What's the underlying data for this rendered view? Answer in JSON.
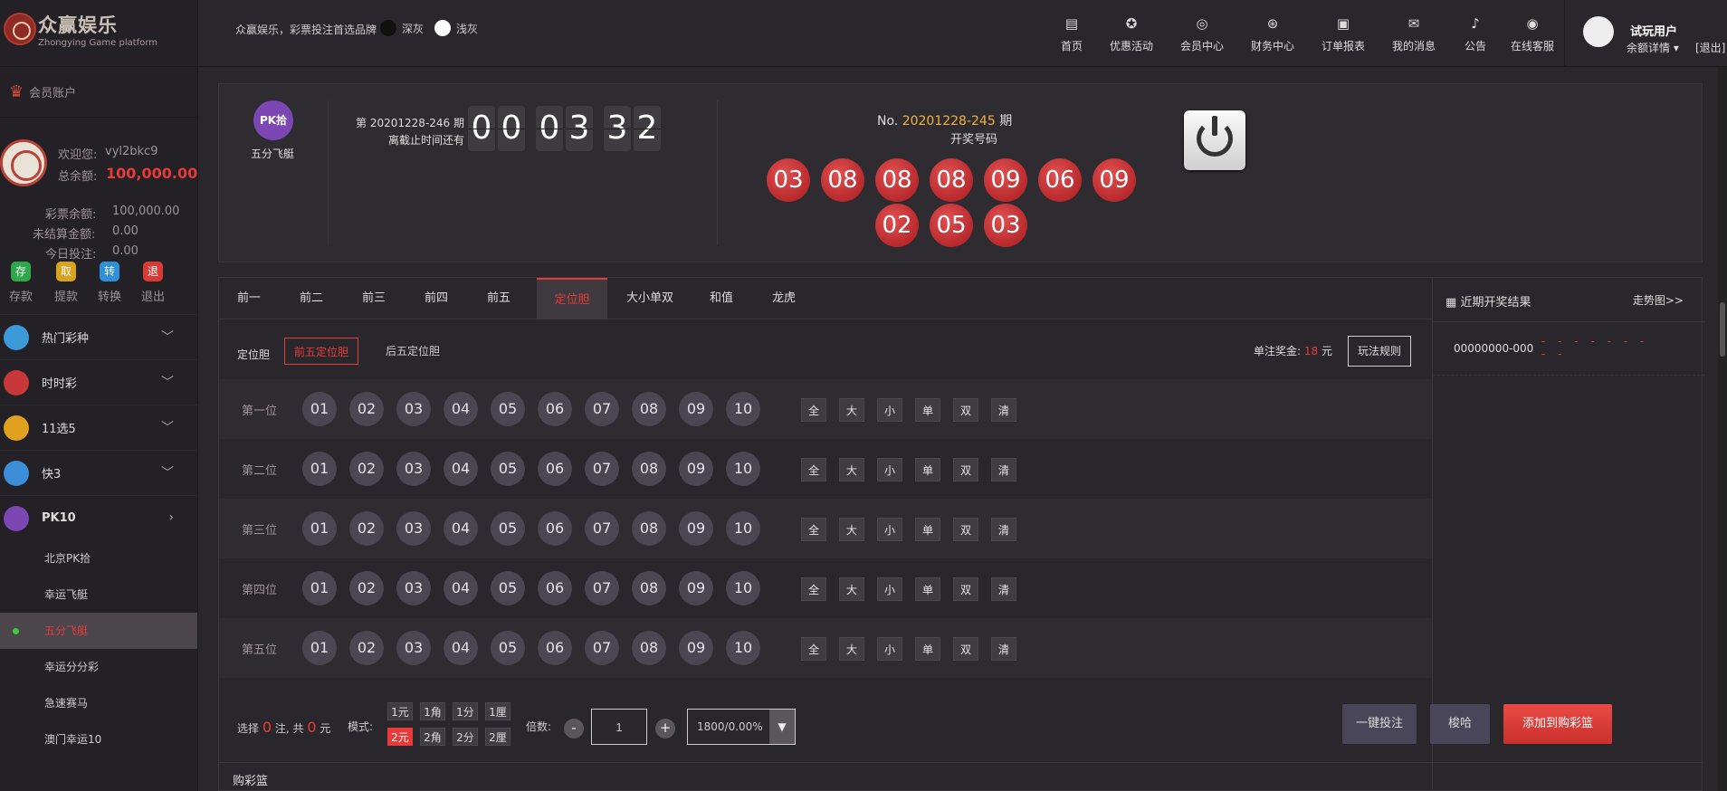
{
  "brand": {
    "name": "众赢娱乐",
    "sub": "Zhongying Game platform"
  },
  "header": {
    "slogan": "众赢娱乐，彩票投注首选品牌",
    "theme_dark": "深灰",
    "theme_light": "浅灰",
    "nav": [
      {
        "label": "首页",
        "icon": "home-icon"
      },
      {
        "label": "优惠活动",
        "icon": "gift-icon"
      },
      {
        "label": "会员中心",
        "icon": "user-icon"
      },
      {
        "label": "财务中心",
        "icon": "finance-icon"
      },
      {
        "label": "订单报表",
        "icon": "report-icon"
      },
      {
        "label": "我的消息",
        "icon": "mail-icon"
      },
      {
        "label": "公告",
        "icon": "bell-icon"
      },
      {
        "label": "在线客服",
        "icon": "support-icon"
      }
    ],
    "user": {
      "name": "试玩用户",
      "detail": "余额详情",
      "logout": "[退出]"
    }
  },
  "sidebar": {
    "account_title": "会员账户",
    "welcome_label": "欢迎您:",
    "username": "vyl2bkc9",
    "total_label": "总余额:",
    "total_value": "100,000.00",
    "lottery_label": "彩票余额:",
    "lottery_value": "100,000.00",
    "unsettled_label": "未结算金额:",
    "unsettled_value": "0.00",
    "today_label": "今日投注:",
    "today_value": "0.00",
    "quick": [
      {
        "icon": "存",
        "label": "存款",
        "color": "#2ea84a"
      },
      {
        "icon": "取",
        "label": "提款",
        "color": "#d8a11e"
      },
      {
        "icon": "转",
        "label": "转换",
        "color": "#2f8fd8"
      },
      {
        "icon": "退",
        "label": "退出",
        "color": "#d83a36"
      }
    ],
    "categories": [
      {
        "label": "热门彩种",
        "color": "#3d9ad9"
      },
      {
        "label": "时时彩",
        "color": "#c8383a"
      },
      {
        "label": "11选5",
        "color": "#e0a11f"
      },
      {
        "label": "快3",
        "color": "#3c8ed8"
      },
      {
        "label": "PK10",
        "color": "#7d47b3"
      }
    ],
    "sub_items": [
      "北京PK拾",
      "幸运飞艇",
      "五分飞艇",
      "幸运分分彩",
      "急速赛马",
      "澳门幸运10"
    ]
  },
  "game": {
    "icon_text": "PK拾",
    "name": "五分飞艇",
    "issue_line": "第 20201228-246 期",
    "deadline_label": "离截止时间还有",
    "countdown": [
      "0",
      "0",
      "0",
      "3",
      "3",
      "2"
    ],
    "last_no_prefix": "No.",
    "last_no": "20201228-245",
    "last_no_suffix": "期",
    "draw_label": "开奖号码",
    "draw_numbers": [
      "03",
      "08",
      "08",
      "08",
      "09",
      "06",
      "09",
      "02",
      "05",
      "03"
    ]
  },
  "bet": {
    "tabs": [
      "前一",
      "前二",
      "前三",
      "前四",
      "前五",
      "定位胆",
      "大小单双",
      "和值",
      "龙虎"
    ],
    "active_tab": 5,
    "sub_label": "定位胆",
    "sub_options": [
      "前五定位胆",
      "后五定位胆"
    ],
    "prize_label": "单注奖金:",
    "prize_value": "18",
    "prize_unit": "元",
    "rule_button": "玩法规则",
    "positions": [
      "第一位",
      "第二位",
      "第三位",
      "第四位",
      "第五位"
    ],
    "numbers": [
      "01",
      "02",
      "03",
      "04",
      "05",
      "06",
      "07",
      "08",
      "09",
      "10"
    ],
    "quick_select": [
      "全",
      "大",
      "小",
      "单",
      "双",
      "清"
    ],
    "selection_prefix": "选择",
    "selection_count": "0",
    "selection_mid": "注, 共",
    "selection_amount": "0",
    "selection_unit": "元",
    "mode_label": "模式:",
    "modes_row1": [
      "1元",
      "1角",
      "1分",
      "1厘"
    ],
    "modes_row2": [
      "2元",
      "2角",
      "2分",
      "2厘"
    ],
    "multiple_label": "倍数:",
    "minus": "-",
    "plus": "+",
    "multiple_value": "1",
    "rebate": "1800/0.00%",
    "btn_one_click": "一键投注",
    "btn_shuffle": "梭哈",
    "btn_add": "添加到购彩篮",
    "basket_title": "购彩篮"
  },
  "recent": {
    "title": "近期开奖结果",
    "trend": "走势图>>",
    "rows": [
      {
        "id": "00000000-000",
        "dots": "- - - - - - - - -"
      }
    ]
  }
}
